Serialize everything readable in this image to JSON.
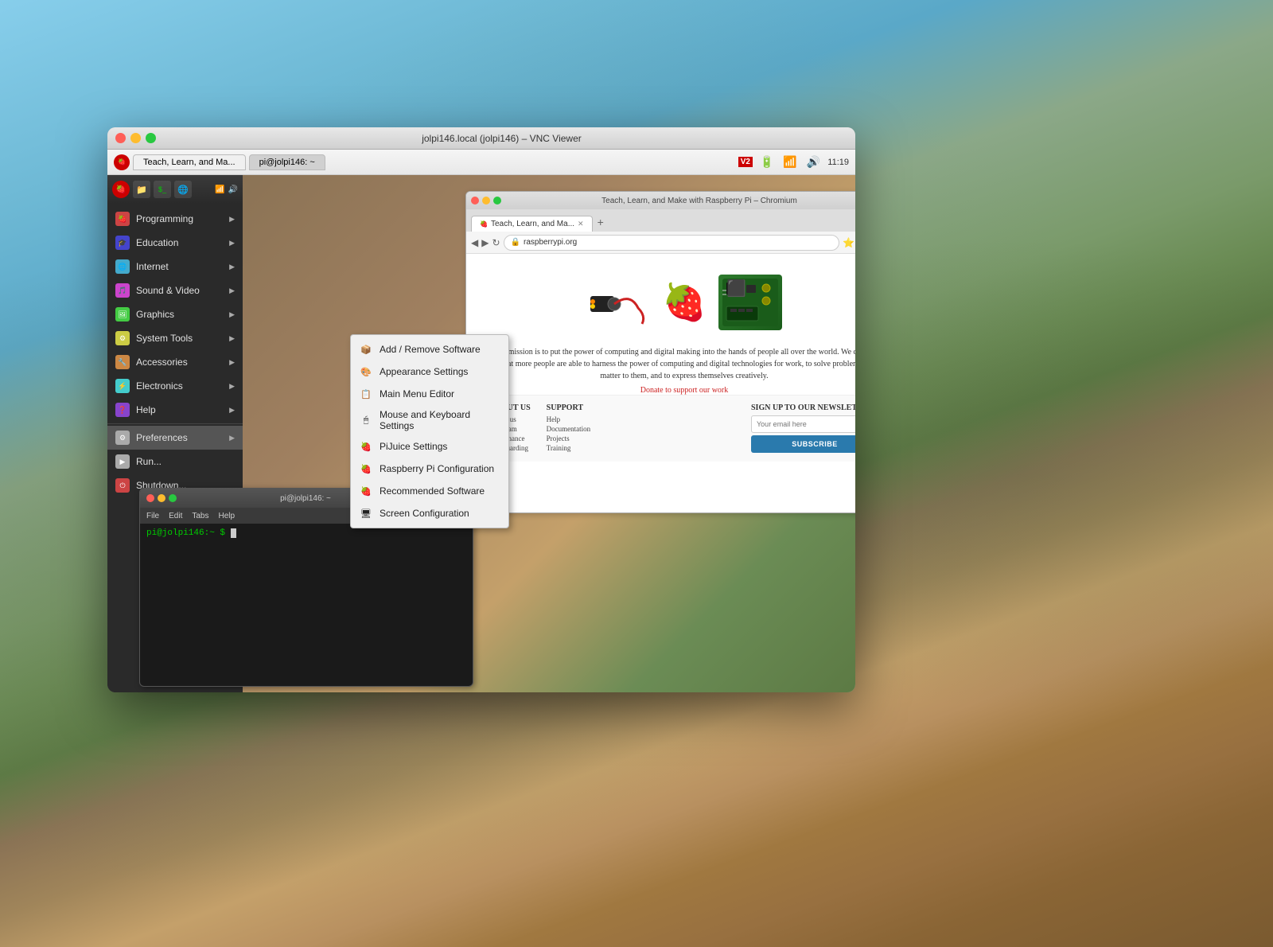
{
  "desktop": {
    "background_note": "macOS Catalina-style mountain landscape"
  },
  "vnc_window": {
    "title": "jolpi146.local (jolpi146) – VNC Viewer",
    "controls": {
      "close": "✕",
      "minimize": "–",
      "maximize": "+"
    },
    "toolbar": {
      "tab1_label": "Teach, Learn, and Ma...",
      "tab2_label": "pi@jolpi146: ~",
      "time": "11:19"
    }
  },
  "rpi_menu": {
    "items": [
      {
        "label": "Programming",
        "arrow": "▶",
        "icon_char": "🍓"
      },
      {
        "label": "Education",
        "arrow": "▶",
        "icon_char": "🎓"
      },
      {
        "label": "Internet",
        "arrow": "▶",
        "icon_char": "🌐"
      },
      {
        "label": "Sound & Video",
        "arrow": "▶",
        "icon_char": "🎵"
      },
      {
        "label": "Graphics",
        "arrow": "▶",
        "icon_char": "🖼"
      },
      {
        "label": "System Tools",
        "arrow": "▶",
        "icon_char": "⚙"
      },
      {
        "label": "Accessories",
        "arrow": "▶",
        "icon_char": "🔧"
      },
      {
        "label": "Electronics",
        "arrow": "▶",
        "icon_char": "⚡"
      },
      {
        "label": "Help",
        "arrow": "▶",
        "icon_char": "❓"
      },
      {
        "label": "Preferences",
        "arrow": "▶",
        "icon_char": "⚙"
      },
      {
        "label": "Run...",
        "arrow": "",
        "icon_char": "▶"
      },
      {
        "label": "Shutdown...",
        "arrow": "",
        "icon_char": "⏻"
      }
    ]
  },
  "prefs_submenu": {
    "items": [
      {
        "label": "Add / Remove Software",
        "icon_char": "📦"
      },
      {
        "label": "Appearance Settings",
        "icon_char": "🎨"
      },
      {
        "label": "Main Menu Editor",
        "icon_char": "📋"
      },
      {
        "label": "Mouse and Keyboard Settings",
        "icon_char": "🖱"
      },
      {
        "label": "PiJuice Settings",
        "icon_char": "🍓"
      },
      {
        "label": "Raspberry Pi Configuration",
        "icon_char": "🍓"
      },
      {
        "label": "Recommended Software",
        "icon_char": "🍓"
      },
      {
        "label": "Screen Configuration",
        "icon_char": "🖥"
      }
    ]
  },
  "browser": {
    "title": "Teach, Learn, and Make with Raspberry Pi – Chromium",
    "tab_label": "Teach, Learn, and Ma...",
    "url": "raspberrypi.org",
    "website": {
      "mission_text": "Our mission is to put the power of computing and digital making into the hands of people all over the world. We do this so that more people are able to harness the power of computing and digital technologies for work, to solve problems that matter to them, and to express themselves creatively.",
      "donate_text": "Donate to support our work",
      "footer": {
        "about_us": {
          "heading": "ABOUT US",
          "links": [
            "About us",
            "Our team",
            "Governance",
            "Safeguarding"
          ]
        },
        "support": {
          "heading": "SUPPORT",
          "links": [
            "Help",
            "Documentation",
            "Projects",
            "Training"
          ]
        },
        "newsletter": {
          "heading": "SIGN UP TO OUR NEWSLETTER",
          "email_placeholder": "Your email here",
          "subscribe_label": "SUBSCRIBE"
        }
      }
    }
  },
  "terminal": {
    "title": "pi@jolpi146: ~",
    "menu_items": [
      "File",
      "Edit",
      "Tabs",
      "Help"
    ],
    "prompt": "pi@jolpi146:~ $",
    "prompt_color": "#00cc00"
  }
}
